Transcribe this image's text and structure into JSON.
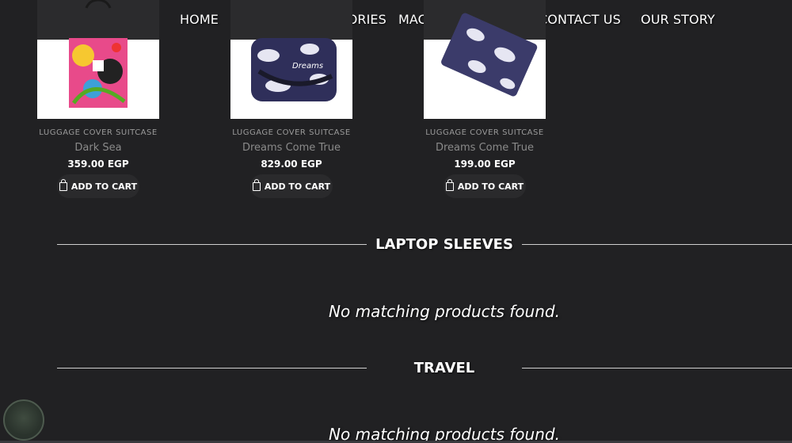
{
  "nav": {
    "items": [
      "HOME",
      "LAPTOP ACCESSORIES",
      "MACBOOK COVERS",
      "CONTACT US",
      "OUR STORY"
    ]
  },
  "products": [
    {
      "category": "LUGGAGE COVER SUITCASE",
      "name": "Dark Sea",
      "price": "359.00 EGP",
      "cta": "ADD TO CART",
      "image_icon": "tote-bag-image"
    },
    {
      "category": "LUGGAGE COVER SUITCASE",
      "name": "Dreams Come True",
      "price": "829.00 EGP",
      "cta": "ADD TO CART",
      "image_icon": "duffel-bag-image"
    },
    {
      "category": "LUGGAGE COVER SUITCASE",
      "name": "Dreams Come True",
      "price": "199.00 EGP",
      "cta": "ADD TO CART",
      "image_icon": "laptop-sleeve-image"
    }
  ],
  "sections": [
    {
      "title": "LAPTOP SLEEVES",
      "empty_message": "No matching products found."
    },
    {
      "title": "TRAVEL",
      "empty_message": "No matching products found."
    }
  ],
  "colors": {
    "background": "#212123",
    "text": "#ffffff",
    "muted": "#8a8a8a",
    "divider": "#cfcfcf"
  }
}
